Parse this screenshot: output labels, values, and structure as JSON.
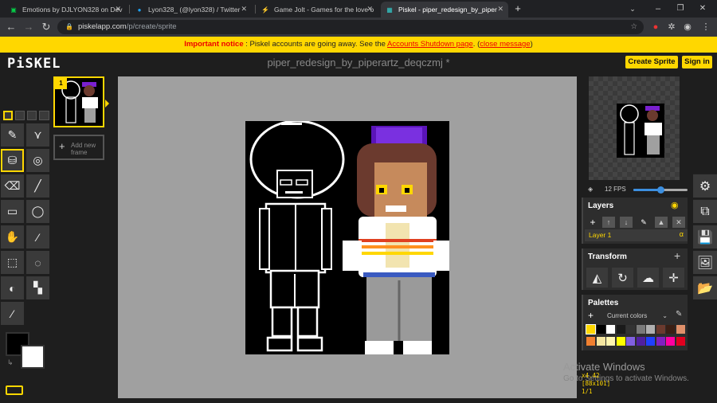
{
  "browser": {
    "tabs": [
      {
        "title": "Emotions by DJLYON328 on Dev",
        "icon": "deviantart-icon"
      },
      {
        "title": "Lyon328_ (@lyon328) / Twitter",
        "icon": "twitter-icon"
      },
      {
        "title": "Game Jolt - Games for the love o",
        "icon": "gamejolt-icon"
      },
      {
        "title": "Piskel - piper_redesign_by_piper",
        "icon": "piskel-icon"
      }
    ],
    "url_host": "piskelapp.com",
    "url_path": "/p/create/sprite"
  },
  "notice": {
    "important": "Important notice",
    "text": " : Piskel accounts are going away. See the ",
    "link": "Accounts Shutdown page",
    "dot": ". (",
    "close": "close message",
    "end": ")"
  },
  "header": {
    "logo": "PiSKEL",
    "doc_title": "piper_redesign_by_piperartz_deqczmj *",
    "create_sprite": "Create Sprite",
    "sign_in": "Sign in"
  },
  "frames": {
    "frame_number": "1",
    "add_frame": "Add new frame"
  },
  "preview": {
    "fps": "12 FPS",
    "fps_value": 12
  },
  "layers": {
    "title": "Layers",
    "layer_name": "Layer 1",
    "alpha": "α"
  },
  "transform": {
    "title": "Transform"
  },
  "palettes": {
    "title": "Palettes",
    "current": "Current colors",
    "colors": [
      "#ffd700",
      "#000000",
      "#ffffff",
      "#1a1a1a",
      "#333333",
      "#7a7a7a",
      "#b0b0b0",
      "#6b3a2e",
      "#3b1f14",
      "#e0906a",
      "#f08030",
      "#f5e6a0",
      "#fff5b0",
      "#ffff00",
      "#8060e0",
      "#5020a0",
      "#2040ff",
      "#8020c0",
      "#ff00a0",
      "#e00020"
    ]
  },
  "status": {
    "watermark": "Activate Windows",
    "watermark_sub": "Go to Settings to activate Windows.",
    "coords": "x4.42",
    "size": "[88x101]",
    "frame": "1/1"
  }
}
